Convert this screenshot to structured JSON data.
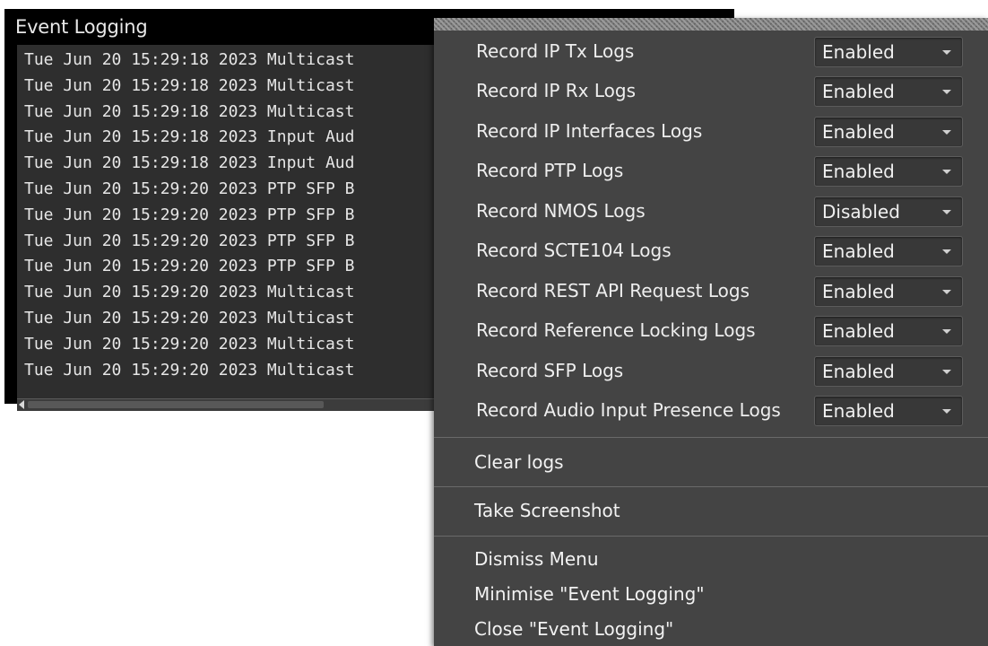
{
  "window": {
    "title": "Event Logging",
    "log_lines": [
      "Tue Jun 20 15:29:18 2023 Multicast",
      "Tue Jun 20 15:29:18 2023 Multicast",
      "Tue Jun 20 15:29:18 2023 Multicast",
      "Tue Jun 20 15:29:18 2023 Input Aud",
      "Tue Jun 20 15:29:18 2023 Input Aud",
      "Tue Jun 20 15:29:20 2023 PTP SFP B",
      "Tue Jun 20 15:29:20 2023 PTP SFP B",
      "Tue Jun 20 15:29:20 2023 PTP SFP B",
      "Tue Jun 20 15:29:20 2023 PTP SFP B",
      "Tue Jun 20 15:29:20 2023 Multicast",
      "Tue Jun 20 15:29:20 2023 Multicast",
      "Tue Jun 20 15:29:20 2023 Multicast",
      "Tue Jun 20 15:29:20 2023 Multicast"
    ]
  },
  "menu": {
    "settings": [
      {
        "label": "Record IP Tx Logs",
        "value": "Enabled"
      },
      {
        "label": "Record IP Rx Logs",
        "value": "Enabled"
      },
      {
        "label": "Record IP Interfaces Logs",
        "value": "Enabled"
      },
      {
        "label": "Record PTP Logs",
        "value": "Enabled"
      },
      {
        "label": "Record NMOS Logs",
        "value": "Disabled"
      },
      {
        "label": "Record SCTE104 Logs",
        "value": "Enabled"
      },
      {
        "label": "Record REST API Request Logs",
        "value": "Enabled"
      },
      {
        "label": "Record Reference Locking Logs",
        "value": "Enabled"
      },
      {
        "label": "Record SFP Logs",
        "value": "Enabled"
      },
      {
        "label": "Record Audio Input Presence Logs",
        "value": "Enabled"
      }
    ],
    "clear_logs": "Clear logs",
    "take_screenshot": "Take Screenshot",
    "dismiss_menu": "Dismiss Menu",
    "minimise": "Minimise \"Event Logging\"",
    "close": "Close \"Event Logging\""
  },
  "icons": {
    "dropdown": "chevron-down-icon",
    "scroll_left": "arrow-left-icon"
  }
}
